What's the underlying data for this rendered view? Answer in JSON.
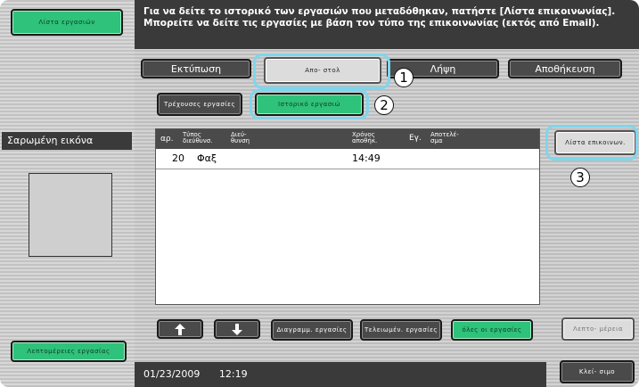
{
  "header": {
    "line1": "Για να δείτε το ιστορικό των εργασιών που μεταδόθηκαν, πατήστε [Λίστα επικοινωνίας].",
    "line2": "Μπορείτε να δείτε τις εργασίες με βάση τον τύπο της επικοινωνίας (εκτός από Email)."
  },
  "left": {
    "job_list_button": "Λίστα εργασιών",
    "scanned_image_label": "Σαρωμένη εικόνα",
    "job_details_button": "Λεπτομέρειες εργασίας"
  },
  "tabs": {
    "print": "Εκτύπωση",
    "send": "Απο- στολ",
    "receive": "Λήψη",
    "save": "Αποθήκευση"
  },
  "subtabs": {
    "current": "Τρέχουσες εργασίες",
    "history": "Ιστορικό εργασιώ"
  },
  "table": {
    "headers": {
      "no": "αρ.",
      "type": "Τύπος διεύθυνσ.",
      "address": "Διεύ- θυνση",
      "time": "Χρόνος αποθήκ.",
      "count": "Εγ.",
      "result": "Αποτελέ- σμα"
    },
    "rows": [
      {
        "no": "20",
        "type": "Φαξ",
        "address": "",
        "time": "14:49",
        "count": "",
        "result": ""
      }
    ]
  },
  "buttons": {
    "comm_list": "Λίστα επικοινων.",
    "delete_jobs": "Διαγραμμ. εργασίες",
    "finished_jobs": "Τελειωμέν. εργασίες",
    "all_jobs": "όλες οι εργασίες",
    "details": "Λεπτο- μέρεια",
    "close": "Κλεί- σιμο"
  },
  "callouts": {
    "one": "1",
    "two": "2",
    "three": "3"
  },
  "footer": {
    "date": "01/23/2009",
    "time": "12:19"
  },
  "colors": {
    "accent_green": "#2ec27a",
    "callout_blue": "#7fd6ec",
    "dark": "#3a3a3a"
  }
}
